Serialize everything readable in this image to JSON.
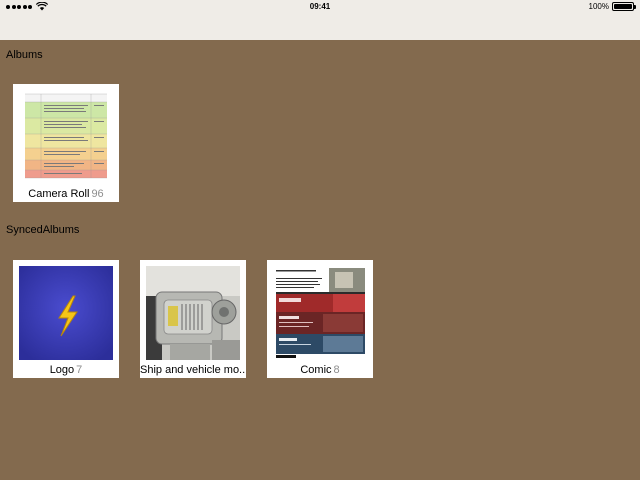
{
  "status_bar": {
    "time": "09:41",
    "battery_text": "100%",
    "battery_level": 1.0
  },
  "sections": {
    "albums": {
      "title": "Albums"
    },
    "synced": {
      "title": "SyncedAlbums"
    }
  },
  "albums": [
    {
      "name": "Camera Roll",
      "count": "96"
    }
  ],
  "synced_albums": [
    {
      "name": "Logo",
      "count": "7"
    },
    {
      "name": "Ship and vehicle mo...",
      "count": ""
    },
    {
      "name": "Comic",
      "count": "8"
    }
  ],
  "colors": {
    "background": "#836a4e",
    "status_bar": "#efece7",
    "logo_bg": "#3d3fb5",
    "bolt": "#f5c518"
  }
}
